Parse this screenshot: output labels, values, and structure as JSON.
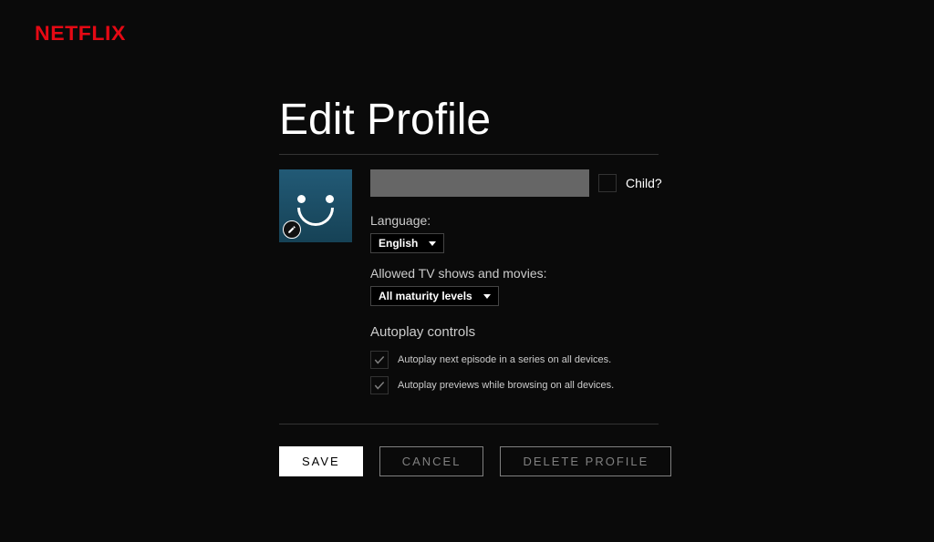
{
  "brand": "NETFLIX",
  "page": {
    "title": "Edit Profile"
  },
  "profile": {
    "name_value": "",
    "child_label": "Child?"
  },
  "language": {
    "label": "Language:",
    "selected": "English"
  },
  "maturity": {
    "label": "Allowed TV shows and movies:",
    "selected": "All maturity levels"
  },
  "autoplay": {
    "header": "Autoplay controls",
    "items": [
      "Autoplay next episode in a series on all devices.",
      "Autoplay previews while browsing on all devices."
    ]
  },
  "buttons": {
    "save": "SAVE",
    "cancel": "CANCEL",
    "delete": "DELETE PROFILE"
  }
}
